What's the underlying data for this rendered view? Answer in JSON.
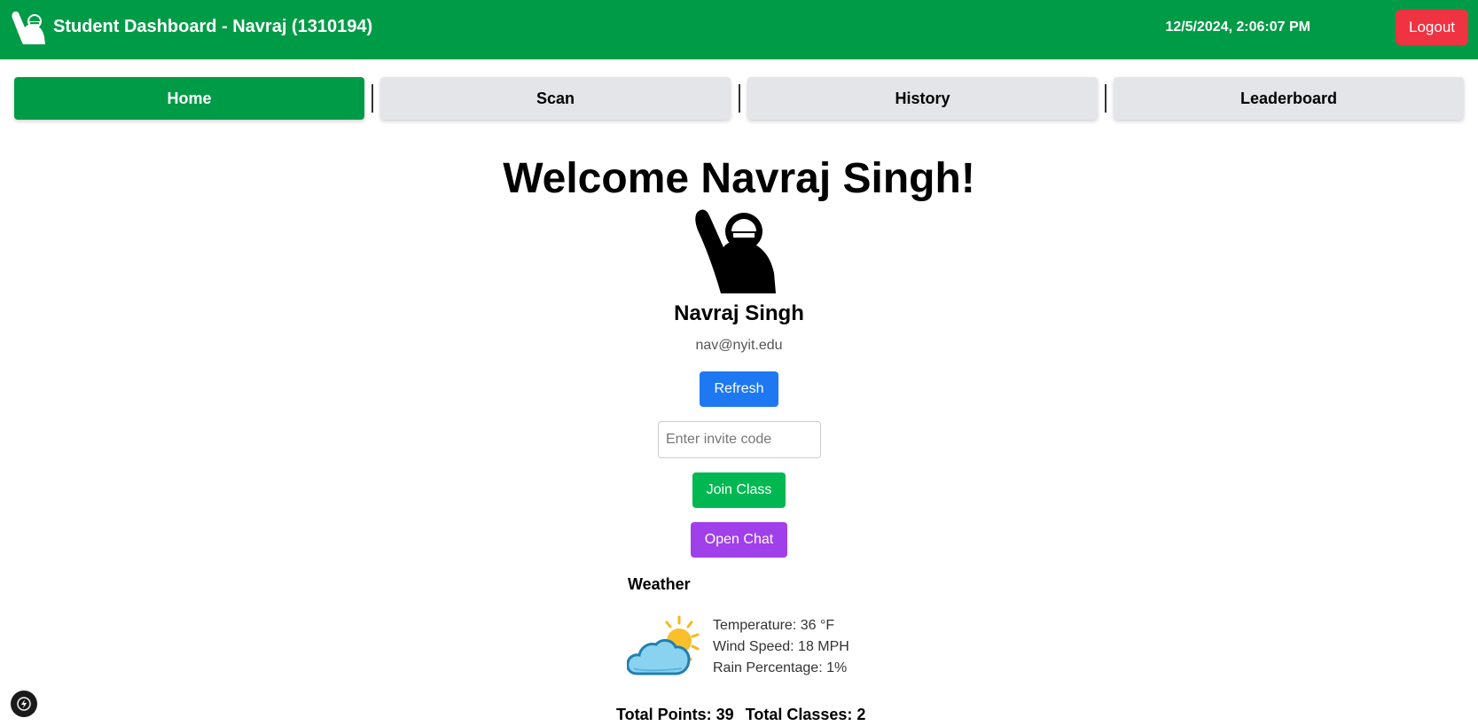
{
  "header": {
    "title": "Student Dashboard - Navraj (1310194)",
    "datetime": "12/5/2024, 2:06:07 PM",
    "logout_label": "Logout",
    "logo_icon": "raised-hand-person-icon",
    "background_color": "#009b46",
    "logout_color": "#ef3340"
  },
  "nav": {
    "tabs": [
      {
        "label": "Home",
        "active": true
      },
      {
        "label": "Scan",
        "active": false
      },
      {
        "label": "History",
        "active": false
      },
      {
        "label": "Leaderboard",
        "active": false
      }
    ]
  },
  "profile": {
    "welcome": "Welcome Navraj Singh!",
    "avatar_icon": "raised-hand-person-icon",
    "name": "Navraj Singh",
    "email": "nav@nyit.edu"
  },
  "actions": {
    "refresh_label": "Refresh",
    "invite_placeholder": "Enter invite code",
    "invite_value": "",
    "join_label": "Join Class",
    "chat_label": "Open Chat",
    "refresh_color": "#1d78f2",
    "join_color": "#00b752",
    "chat_color": "#a040ea"
  },
  "weather": {
    "title": "Weather",
    "icon": "sun-behind-cloud-icon",
    "temperature": "Temperature: 36 °F",
    "wind": "Wind Speed: 18 MPH",
    "rain": "Rain Percentage: 1%"
  },
  "totals": {
    "points": "Total Points: 39",
    "classes": "Total Classes: 2"
  },
  "corner": {
    "icon": "lightning-bolt-icon"
  }
}
